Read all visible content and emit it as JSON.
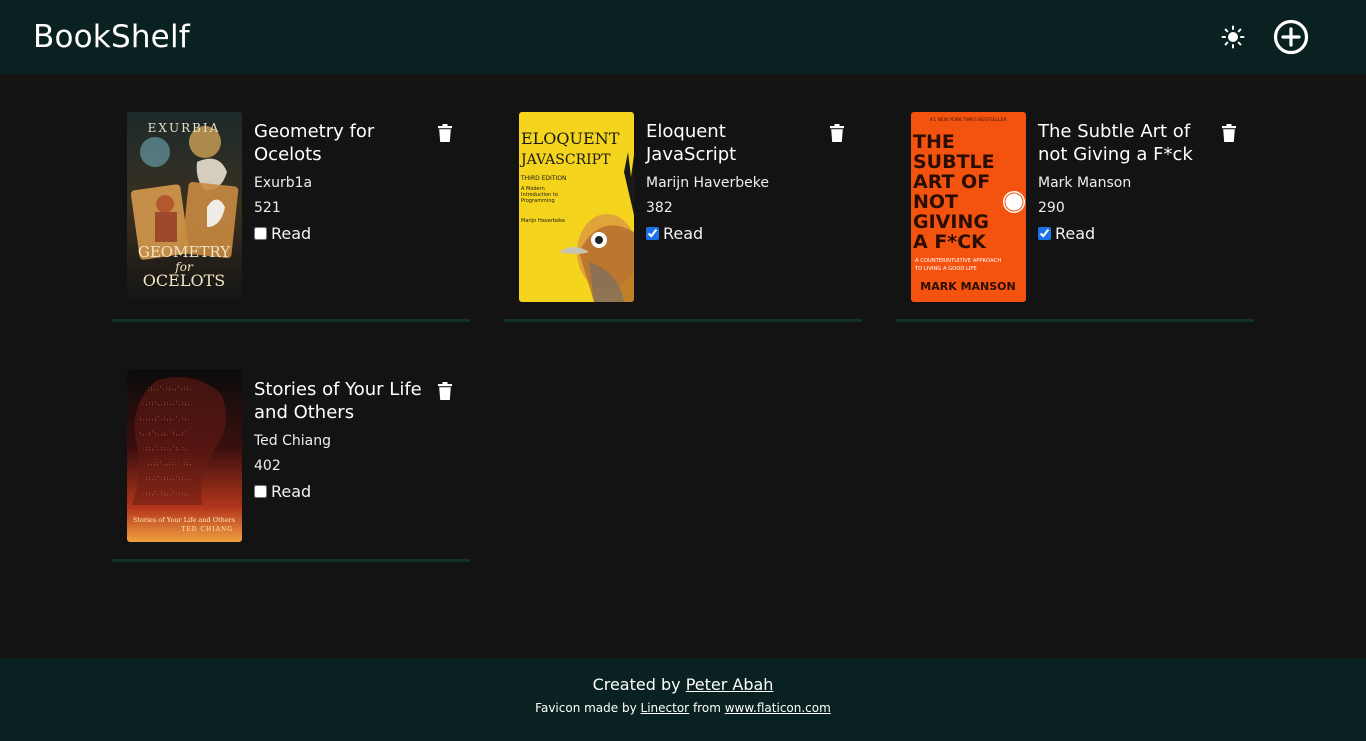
{
  "header": {
    "brand": "BookShelf",
    "theme_toggle_icon": "sun-icon",
    "add_book_icon": "plus-circle-icon"
  },
  "books": [
    {
      "title": "Geometry for Ocelots",
      "author": "Exurb1a",
      "pages": "521",
      "read_label": "Read",
      "read": false,
      "cover": {
        "top_text": "EXURBIA",
        "main_text_1": "GEOMETRY",
        "main_text_2": "for",
        "main_text_3": "OCELOTS"
      }
    },
    {
      "title": "Eloquent JavaScript",
      "author": "Marijn Haverbeke",
      "pages": "382",
      "read_label": "Read",
      "read": true,
      "cover": {
        "main_text_1": "ELOQUENT",
        "main_text_2": "JAVASCRIPT",
        "edition": "THIRD EDITION",
        "subtitle": "A Modern Introduction to Programming",
        "author": "Marijn Haverbeke"
      }
    },
    {
      "title": "The Subtle Art of not Giving a F*ck",
      "author": "Mark Manson",
      "pages": "290",
      "read_label": "Read",
      "read": true,
      "cover": {
        "banner": "#1 NEW YORK TIMES BESTSELLER",
        "lines": [
          "THE",
          "SUBTLE",
          "ART OF",
          "NOT",
          "GIVING",
          "A F*CK"
        ],
        "tagline_1": "A COUNTERINTUITIVE APPROACH",
        "tagline_2": "TO LIVING A GOOD LIFE",
        "author": "MARK MANSON"
      }
    },
    {
      "title": "Stories of Your Life and Others",
      "author": "Ted Chiang",
      "pages": "402",
      "read_label": "Read",
      "read": false,
      "cover": {
        "main_text": "Stories of Your Life and Others",
        "author": "TED CHIANG"
      }
    }
  ],
  "footer": {
    "created_by_prefix": "Created by",
    "creator_name": "Peter Abah",
    "favicon_prefix": "Favicon made by",
    "favicon_author": "Linector",
    "favicon_from": "from",
    "favicon_site": "www.flaticon.com"
  },
  "colors": {
    "header_bg": "#0a2121",
    "page_bg": "#131313",
    "card_border": "#123227",
    "checkbox_accent": "#1a73e8"
  }
}
